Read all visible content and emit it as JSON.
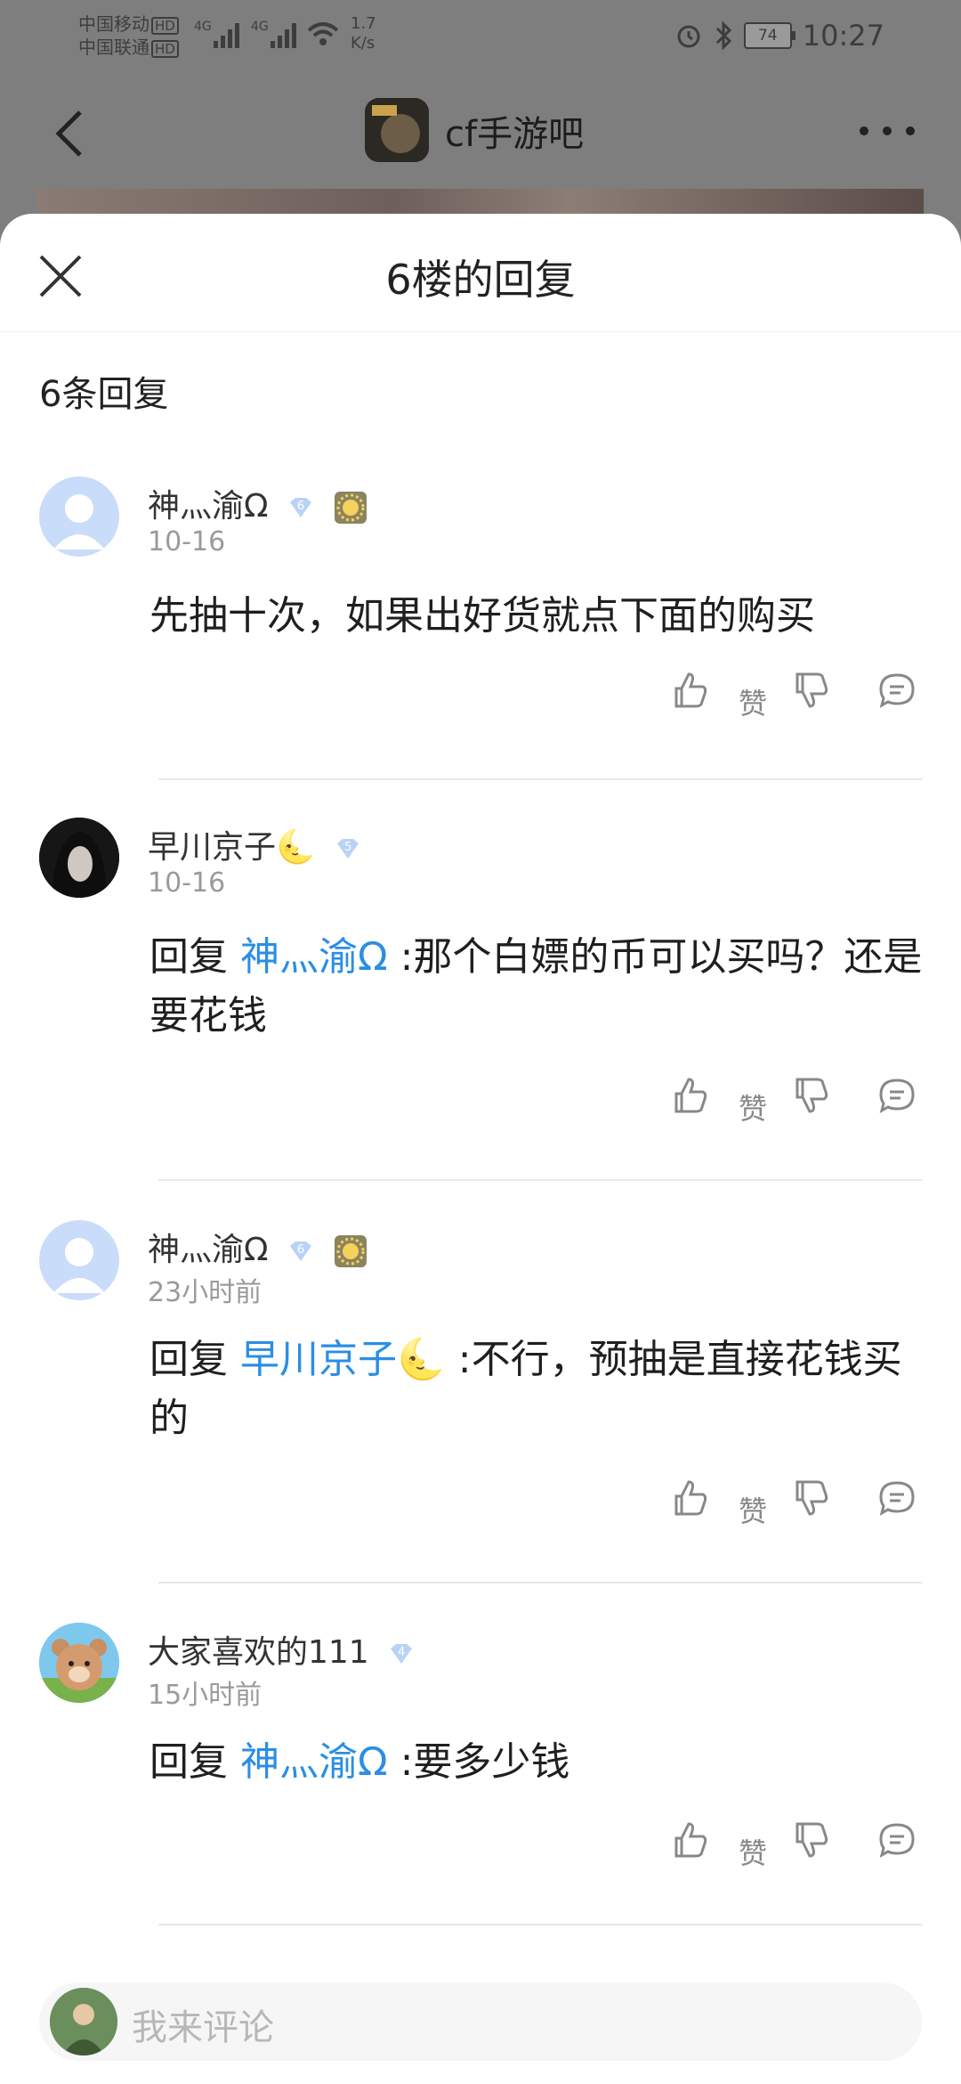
{
  "status_bar": {
    "carrier1": "中国移动",
    "carrier2": "中国联通",
    "hd": "HD",
    "net1": "4G",
    "net2": "4G",
    "speed_value": "1.7",
    "speed_unit": "K/s",
    "battery": "74",
    "time": "10:27"
  },
  "nav": {
    "forum_title": "cf手游吧"
  },
  "sheet": {
    "title": "6楼的回复",
    "reply_count": "6条回复"
  },
  "comments": [
    {
      "username": "神灬渝Ω",
      "level": "6",
      "time": "10-16",
      "text": "先抽十次，如果出好货就点下面的购买",
      "like_label": "赞"
    },
    {
      "username": "早川京子🌜",
      "level": "5",
      "time": "10-16",
      "reply_prefix": "回复",
      "mention": "神灬渝Ω",
      "text_after": " :那个白嫖的币可以买吗？还是要花钱",
      "like_label": "赞"
    },
    {
      "username": "神灬渝Ω",
      "level": "6",
      "time": "23小时前",
      "reply_prefix": "回复",
      "mention": "早川京子🌜",
      "text_after": " :不行，预抽是直接花钱买的",
      "like_label": "赞"
    },
    {
      "username": "大家喜欢的111",
      "level": "4",
      "time": "15小时前",
      "reply_prefix": "回复",
      "mention": "神灬渝Ω",
      "text_after": " :要多少钱",
      "like_label": "赞"
    }
  ],
  "input": {
    "placeholder": "我来评论"
  },
  "colors": {
    "mention": "#2b8ee4",
    "badge": "#b9d3f7",
    "overlay": "#7d7d7d"
  }
}
